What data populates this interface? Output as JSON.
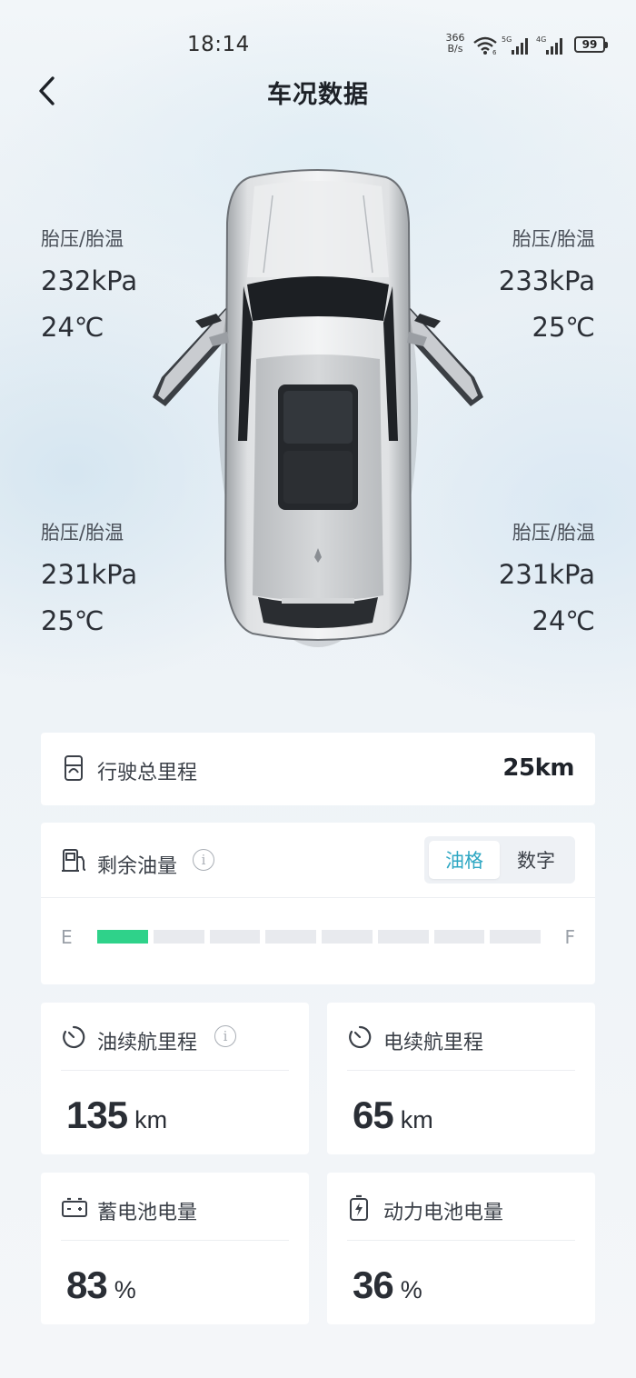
{
  "status_bar": {
    "time": "18:14",
    "net_speed_value": "366",
    "net_speed_unit": "B/s",
    "battery": "99",
    "icons": [
      "wifi-icon",
      "signal-5g-icon",
      "signal-4g-icon",
      "battery-icon"
    ]
  },
  "header": {
    "title": "车况数据",
    "back_icon": "chevron-left-icon"
  },
  "tires": {
    "front_left": {
      "label": "胎压/胎温",
      "pressure": "232kPa",
      "temperature": "24℃"
    },
    "front_right": {
      "label": "胎压/胎温",
      "pressure": "233kPa",
      "temperature": "25℃"
    },
    "rear_left": {
      "label": "胎压/胎温",
      "pressure": "231kPa",
      "temperature": "25℃"
    },
    "rear_right": {
      "label": "胎压/胎温",
      "pressure": "231kPa",
      "temperature": "24℃"
    }
  },
  "mileage": {
    "label": "行驶总里程",
    "value": "25km",
    "icon": "odometer-icon"
  },
  "fuel": {
    "label": "剩余油量",
    "icon": "fuel-pump-icon",
    "toggle": {
      "option_bars": "油格",
      "option_number": "数字",
      "selected": "油格"
    },
    "gauge_empty": "E",
    "gauge_full": "F",
    "segments_total": 8,
    "segments_filled": 1,
    "fill_color": "#2fd28a"
  },
  "stats": {
    "fuel_range": {
      "label": "油续航里程",
      "value": "135",
      "unit": "km",
      "icon": "timer-icon"
    },
    "electric_range": {
      "label": "电续航里程",
      "value": "65",
      "unit": "km",
      "icon": "timer-icon"
    },
    "battery_12v": {
      "label": "蓄电池电量",
      "value": "83",
      "unit": "%",
      "icon": "car-battery-icon"
    },
    "power_battery": {
      "label": "动力电池电量",
      "value": "36",
      "unit": "%",
      "icon": "charging-battery-icon"
    }
  },
  "colors": {
    "accent": "#2ea7c3",
    "fuel_fill": "#2fd28a",
    "text_primary": "#2b2f36",
    "card_bg": "#ffffff"
  }
}
